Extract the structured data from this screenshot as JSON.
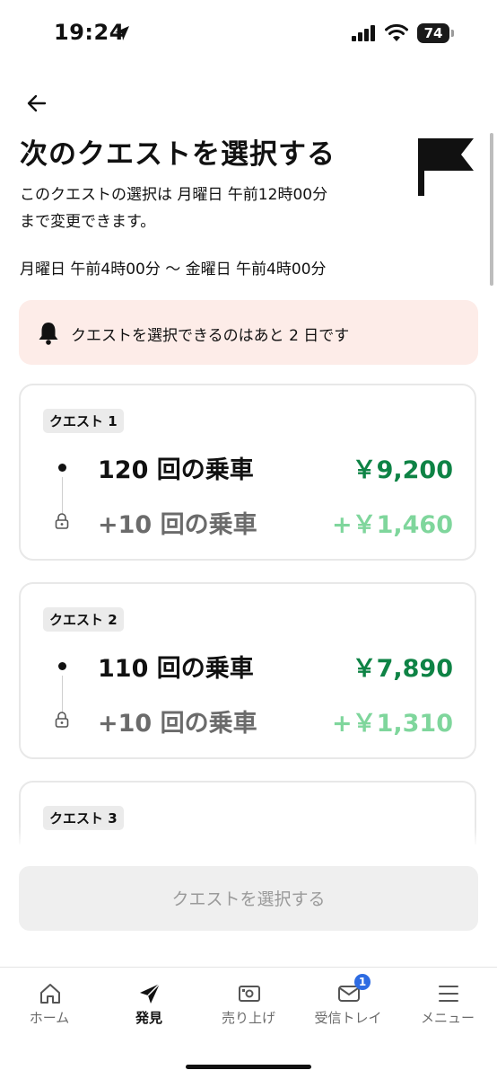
{
  "status_bar": {
    "time": "19:24",
    "battery": "74"
  },
  "header": {
    "title": "次のクエストを選択する",
    "deadline_line1": "このクエストの選択は 月曜日 午前12時00分",
    "deadline_line2": "まで変更できます。",
    "period": "月曜日 午前4時00分 〜 金曜日 午前4時00分"
  },
  "notice": {
    "text": "クエストを選択できるのはあと 2 日です"
  },
  "quests": [
    {
      "tag": "クエスト 1",
      "rides": "120 回の乗車",
      "amount": "￥9,200",
      "bonus_rides": "+10 回の乗車",
      "bonus_amount": "+￥1,460"
    },
    {
      "tag": "クエスト 2",
      "rides": "110 回の乗車",
      "amount": "￥7,890",
      "bonus_rides": "+10 回の乗車",
      "bonus_amount": "+￥1,310"
    },
    {
      "tag": "クエスト 3"
    }
  ],
  "select_button": {
    "label": "クエストを選択する"
  },
  "tabs": [
    {
      "label": "ホーム",
      "icon": "home-icon"
    },
    {
      "label": "発見",
      "icon": "compass-icon",
      "active": true
    },
    {
      "label": "売り上げ",
      "icon": "money-icon"
    },
    {
      "label": "受信トレイ",
      "icon": "mail-icon",
      "badge": "1"
    },
    {
      "label": "メニュー",
      "icon": "menu-icon"
    }
  ],
  "colors": {
    "amount": "#0e8345",
    "bonus_amount": "#7fd69c",
    "notice_bg": "#fdece8",
    "badge": "#2d6be2"
  }
}
